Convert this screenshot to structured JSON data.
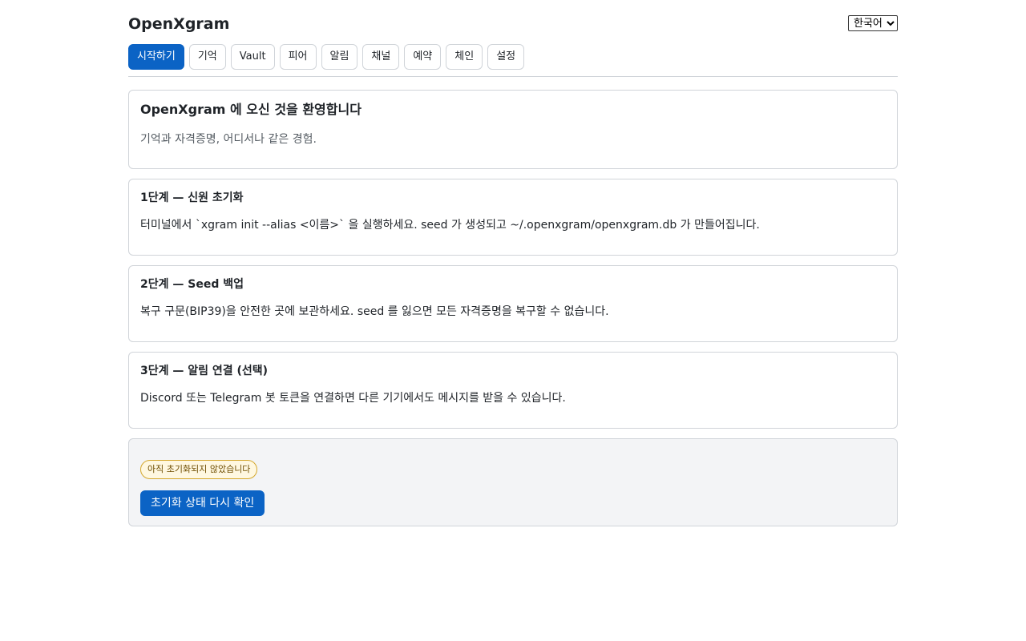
{
  "app": {
    "title": "OpenXgram"
  },
  "language": {
    "selected": "한국어",
    "options": [
      "한국어"
    ]
  },
  "tabs": [
    {
      "label": "시작하기",
      "active": true
    },
    {
      "label": "기억",
      "active": false
    },
    {
      "label": "Vault",
      "active": false
    },
    {
      "label": "피어",
      "active": false
    },
    {
      "label": "알림",
      "active": false
    },
    {
      "label": "채널",
      "active": false
    },
    {
      "label": "예약",
      "active": false
    },
    {
      "label": "체인",
      "active": false
    },
    {
      "label": "설정",
      "active": false
    }
  ],
  "welcome": {
    "title": "OpenXgram 에 오신 것을 환영합니다",
    "subtitle": "기억과 자격증명, 어디서나 같은 경험."
  },
  "steps": [
    {
      "title": "1단계 — 신원 초기화",
      "body": "터미널에서 `xgram init --alias <이름>` 을 실행하세요. seed 가 생성되고 ~/.openxgram/openxgram.db 가 만들어집니다."
    },
    {
      "title": "2단계 — Seed 백업",
      "body": "복구 구문(BIP39)을 안전한 곳에 보관하세요. seed 를 잃으면 모든 자격증명을 복구할 수 없습니다."
    },
    {
      "title": "3단계 — 알림 연결 (선택)",
      "body": "Discord 또는 Telegram 봇 토큰을 연결하면 다른 기기에서도 메시지를 받을 수 있습니다."
    }
  ],
  "status": {
    "badge": "아직 초기화되지 않았습니다",
    "recheck_label": "초기화 상태 다시 확인"
  },
  "colors": {
    "accent": "#0b63c5",
    "border": "#d0d4d9",
    "status_bg": "#f3f4f6",
    "badge_border": "#d4a72c",
    "badge_bg": "#fff8e1"
  }
}
